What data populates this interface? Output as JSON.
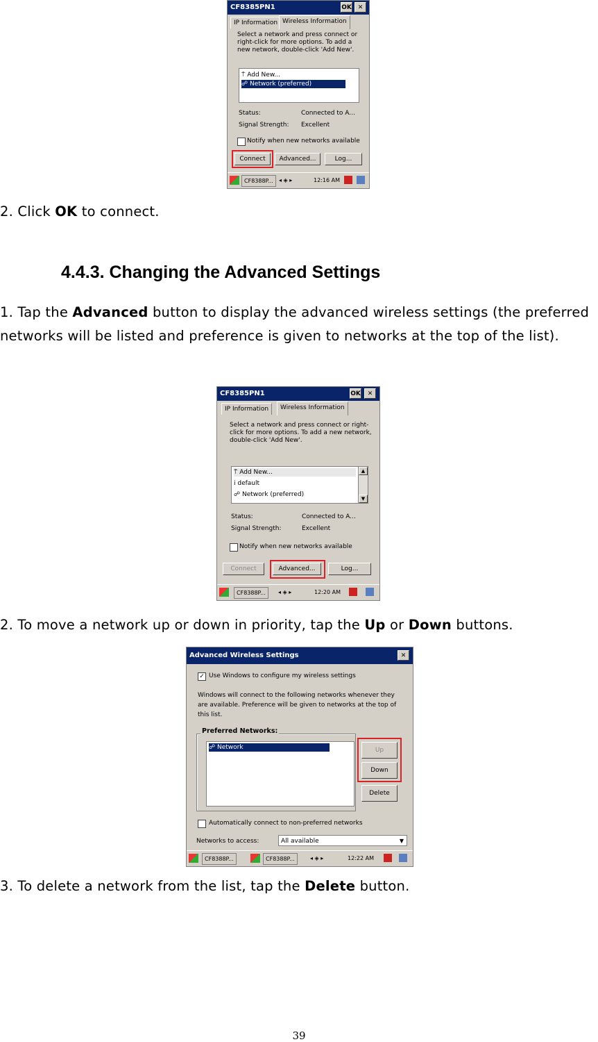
{
  "screenshot1": {
    "title": "CF8385PN1",
    "ok": "OK",
    "close": "✕",
    "tabs": [
      "IP Information",
      "Wireless Information"
    ],
    "description": "Select a network and press connect or right-click for more options.  To add a new network, double-click 'Add New'.",
    "list": [
      "Add New...",
      "Network (preferred)"
    ],
    "status_label": "Status:",
    "status_value": "Connected to A...",
    "signal_label": "Signal Strength:",
    "signal_value": "Excellent",
    "notify": "Notify when new networks available",
    "buttons": [
      "Connect",
      "Advanced...",
      "Log..."
    ],
    "taskbar_app": "CF8388P...",
    "time": "12:16 AM"
  },
  "text_step2_connect": {
    "prefix": "2. Click ",
    "bold": "OK",
    "suffix": " to connect."
  },
  "heading": "4.4.3. Changing the Advanced Settings",
  "text_step1": {
    "prefix": "1. Tap the ",
    "bold": "Advanced",
    "suffix": " button to display the advanced wireless settings (the preferred networks will be listed and preference is given to networks at the top of the list)."
  },
  "screenshot2": {
    "title": "CF8385PN1",
    "ok": "OK",
    "close": "✕",
    "tabs": [
      "IP Information",
      "Wireless Information"
    ],
    "description": "Select a network and press connect or right-click for more options.  To add a new network, double-click 'Add New'.",
    "list": [
      "Add New...",
      "default",
      "Network (preferred)"
    ],
    "status_label": "Status:",
    "status_value": "Connected to A...",
    "signal_label": "Signal Strength:",
    "signal_value": "Excellent",
    "notify": "Notify when new networks available",
    "buttons": [
      "Connect",
      "Advanced...",
      "Log..."
    ],
    "taskbar_app": "CF8388P...",
    "time": "12:20 AM"
  },
  "text_step2_move": {
    "prefix": "2. To move a network up or down in priority, tap the ",
    "bold1": "Up",
    "mid": " or ",
    "bold2": "Down",
    "suffix": " buttons."
  },
  "screenshot3": {
    "title": "Advanced Wireless Settings",
    "close": "✕",
    "use_windows": "Use Windows to configure my wireless settings",
    "description": "Windows will connect to the following networks whenever they are available.  Preference will be given to networks at the top of this list.",
    "group_label": "Preferred Networks:",
    "list": [
      "Network"
    ],
    "buttons": [
      "Up",
      "Down",
      "Delete"
    ],
    "auto_connect": "Automatically connect to non-preferred networks",
    "access_label": "Networks to access:",
    "access_value": "All available",
    "taskbar_apps": [
      "CF8388P...",
      "CF8388P..."
    ],
    "time": "12:22 AM"
  },
  "text_step3": {
    "prefix": "3. To delete a network from the list, tap the ",
    "bold": "Delete",
    "suffix": " button."
  },
  "page_number": "39"
}
